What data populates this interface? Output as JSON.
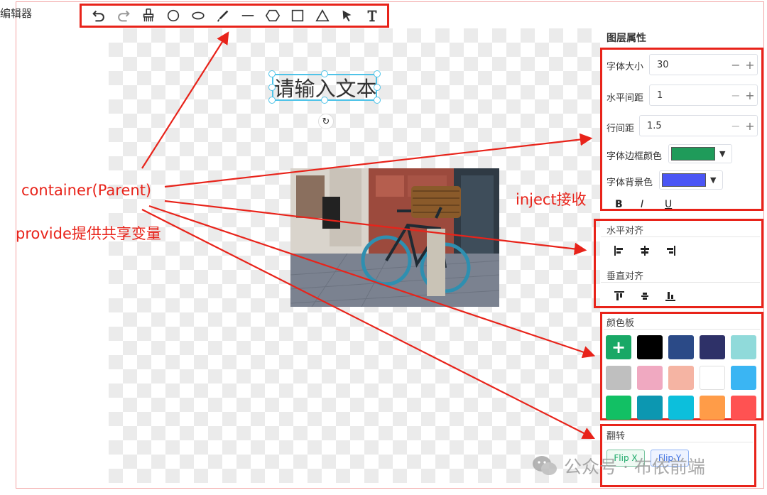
{
  "app": {
    "title": "编辑器"
  },
  "toolbar": {
    "tools": [
      {
        "icon": "undo-icon"
      },
      {
        "icon": "redo-icon"
      },
      {
        "icon": "brush-icon"
      },
      {
        "icon": "circle-icon"
      },
      {
        "icon": "ellipse-icon"
      },
      {
        "icon": "pencil-icon"
      },
      {
        "icon": "line-icon"
      },
      {
        "icon": "hexagon-icon"
      },
      {
        "icon": "rectangle-icon"
      },
      {
        "icon": "triangle-icon"
      },
      {
        "icon": "pointer-icon"
      },
      {
        "icon": "text-icon"
      }
    ]
  },
  "canvas": {
    "text_object": "请输入文本",
    "rotate_glyph": "↻"
  },
  "panel": {
    "title": "图层属性",
    "font_size": {
      "label": "字体大小",
      "value": "30",
      "minus": "−",
      "plus": "+"
    },
    "h_spacing": {
      "label": "水平间距",
      "value": "1",
      "minus": "−",
      "plus": "+"
    },
    "line_spacing": {
      "label": "行间距",
      "value": "1.5",
      "minus": "−",
      "plus": "+"
    },
    "border_color": {
      "label": "字体边框颜色",
      "color": "#1f9b5a"
    },
    "bg_color": {
      "label": "字体背景色",
      "color": "#4a55f5"
    },
    "format": {
      "bold": "B",
      "italic": "I",
      "underline": "U"
    },
    "h_align": {
      "label": "水平对齐"
    },
    "v_align": {
      "label": "垂直对齐"
    },
    "palette": {
      "label": "颜色板",
      "add": "+",
      "colors": [
        "#000000",
        "#2b4a87",
        "#2e3168",
        "#90dada",
        "#bfbfbf",
        "#f0a9c1",
        "#f5b4a3",
        "#ffffff",
        "#3ab5f3",
        "#12c064",
        "#0c97b1",
        "#0cbfdc",
        "#ff9c48",
        "#ff5252"
      ]
    },
    "flip": {
      "label": "翻转",
      "x": "Flip X",
      "y": "Flip Y"
    }
  },
  "annotations": {
    "container": "container(Parent)",
    "provide": "provide提供共享变量",
    "inject": "inject接收"
  },
  "watermark": {
    "text": "公众号 · 布依前端"
  },
  "colors": {
    "annotation_red": "#e8231a",
    "selection_blue": "#4fc3e8",
    "add_green": "#19a866"
  }
}
